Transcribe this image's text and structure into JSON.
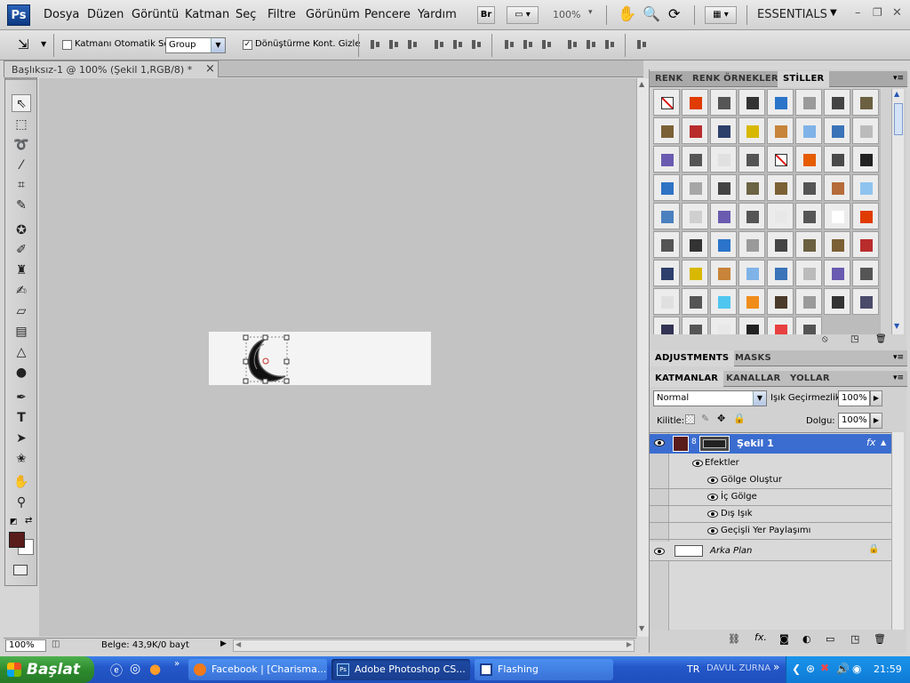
{
  "app": {
    "logo": "Ps"
  },
  "menu": [
    "Dosya",
    "Düzen",
    "Görüntü",
    "Katman",
    "Seç",
    "Filtre",
    "Görünüm",
    "Pencere",
    "Yardım"
  ],
  "toolbar_top": {
    "br_label": "Br",
    "zoom": "100%",
    "workspace": "ESSENTIALS",
    "window_min": "–",
    "window_restore": "❐",
    "window_close": "✕"
  },
  "options": {
    "auto_select_label": "Katmanı Otomatik Seç",
    "auto_select_target": "Group",
    "transform_label": "Dönüştürme Kont. Gizle",
    "auto_select_checked": false,
    "transform_checked": true
  },
  "document": {
    "tab_title": "Başlıksız-1 @ 100% (Şekil 1,RGB/8) *",
    "close": "×"
  },
  "status": {
    "zoom": "100%",
    "info": "Belge: 43,9K/0 bayt"
  },
  "panels": {
    "styles_tabs": [
      "RENK",
      "RENK ÖRNEKLERİ",
      "STİLLER"
    ],
    "styles_active": 2,
    "adjust_tabs": [
      "ADJUSTMENTS",
      "MASKS"
    ],
    "layers_tabs": [
      "KATMANLAR",
      "KANALLAR",
      "YOLLAR"
    ],
    "blend_mode": "Normal",
    "opacity_label": "Işık Geçirmezlik:",
    "opacity": "100%",
    "lock_label": "Kilitle:",
    "fill_label": "Dolgu:",
    "fill": "100%"
  },
  "layers": {
    "shape_layer": "Şekil 1",
    "effects_label": "Efektler",
    "effects": [
      "Gölge Oluştur",
      "İç Gölge",
      "Dış Işık",
      "Geçişli Yer Paylaşımı"
    ],
    "background": "Arka Plan",
    "fx": "fx"
  },
  "style_swatch_colors": [
    "#ffffff",
    "#e03b00",
    "#555555",
    "#333333",
    "#2b74c9",
    "#9a9a9a",
    "#444444",
    "#6b6040",
    "#7b6035",
    "#b92c2c",
    "#2d3f6b",
    "#d8b800",
    "#c7843a",
    "#7fb3e8",
    "#3a73b8",
    "#bbbbbb",
    "#6a5bb0",
    "#555555",
    "#e0e0e0",
    "#555555",
    "#ffffff",
    "#e65c00",
    "#4a4a4a",
    "#222222",
    "#2f72c4",
    "#a6a6a6",
    "#444444",
    "#6c6344",
    "#7b6035",
    "#555555",
    "#b56b3a",
    "#8fc3ef",
    "#4a80bf",
    "#cfcfcf",
    "#6a5bb0",
    "#555555",
    "#e8e8e8",
    "#555555",
    "#ffffff",
    "#e03b00",
    "#555555",
    "#333333",
    "#2b74c9",
    "#9a9a9a",
    "#444444",
    "#6b6040",
    "#7b6035",
    "#b92c2c",
    "#2d3f6b",
    "#d8b800",
    "#c7843a",
    "#7fb3e8",
    "#3a73b8",
    "#bbbbbb",
    "#6a5bb0",
    "#555555",
    "#e0e0e0",
    "#555555",
    "#4fc6f0",
    "#f08c1a",
    "#4a3a2a",
    "#9a9a9a",
    "#333333",
    "#4a4a6a",
    "#333355",
    "#555555",
    "#e8e8e8",
    "#222222",
    "#e84040",
    "#555555"
  ],
  "taskbar": {
    "start": "Başlat",
    "tasks": [
      "Facebook | [Charisma...",
      "Adobe Photoshop CS...",
      "Flashing"
    ],
    "lang": "TR",
    "user_text": "DAVUL ZURNA",
    "clock": "21:59"
  }
}
